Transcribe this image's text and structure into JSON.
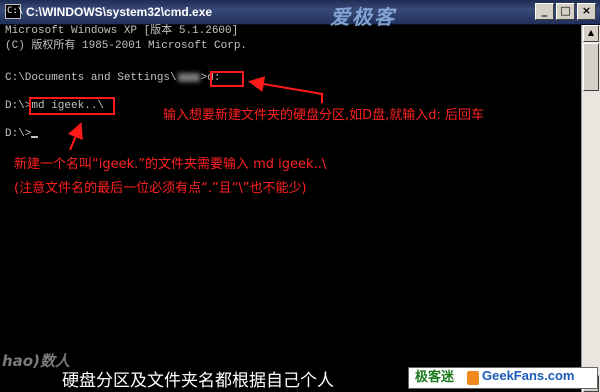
{
  "window": {
    "title": "C:\\WINDOWS\\system32\\cmd.exe",
    "icon_glyph": "C:\\",
    "watermark": "爱极客",
    "buttons": {
      "minimize": "_",
      "maximize": "□",
      "close": "×"
    }
  },
  "console": {
    "line1": "Microsoft Windows XP [版本 5.1.2600]",
    "line2": "(C) 版权所有 1985-2001 Microsoft Corp.",
    "line3_prefix": "C:\\Documents and Settings\\",
    "line3_cmd": "d:",
    "line4_prompt": "D:\\>",
    "line4_cmd": "md igeek..\\",
    "line5_prompt": "D:\\>"
  },
  "annotations": {
    "drive_tip": "输入想要新建文件夹的硬盘分区,如D盘,就输入d: 后回车",
    "md_tip_line1": "新建一个名叫“igeek.”的文件夹需要输入 md igeek..\\",
    "md_tip_line2": "(注意文件名的最后一位必须有点“.”且“\\”也不能少)"
  },
  "caption": "硬盘分区及文件夹名都根据自己个人",
  "logos": {
    "bottom_left": "hao)数人",
    "brand_cn": "极客迷",
    "brand_en": "GeekFans.com"
  },
  "colors": {
    "annotation": "#ff1a1a",
    "console_text": "#c0c0c0",
    "titlebar": "#2b3b68"
  }
}
